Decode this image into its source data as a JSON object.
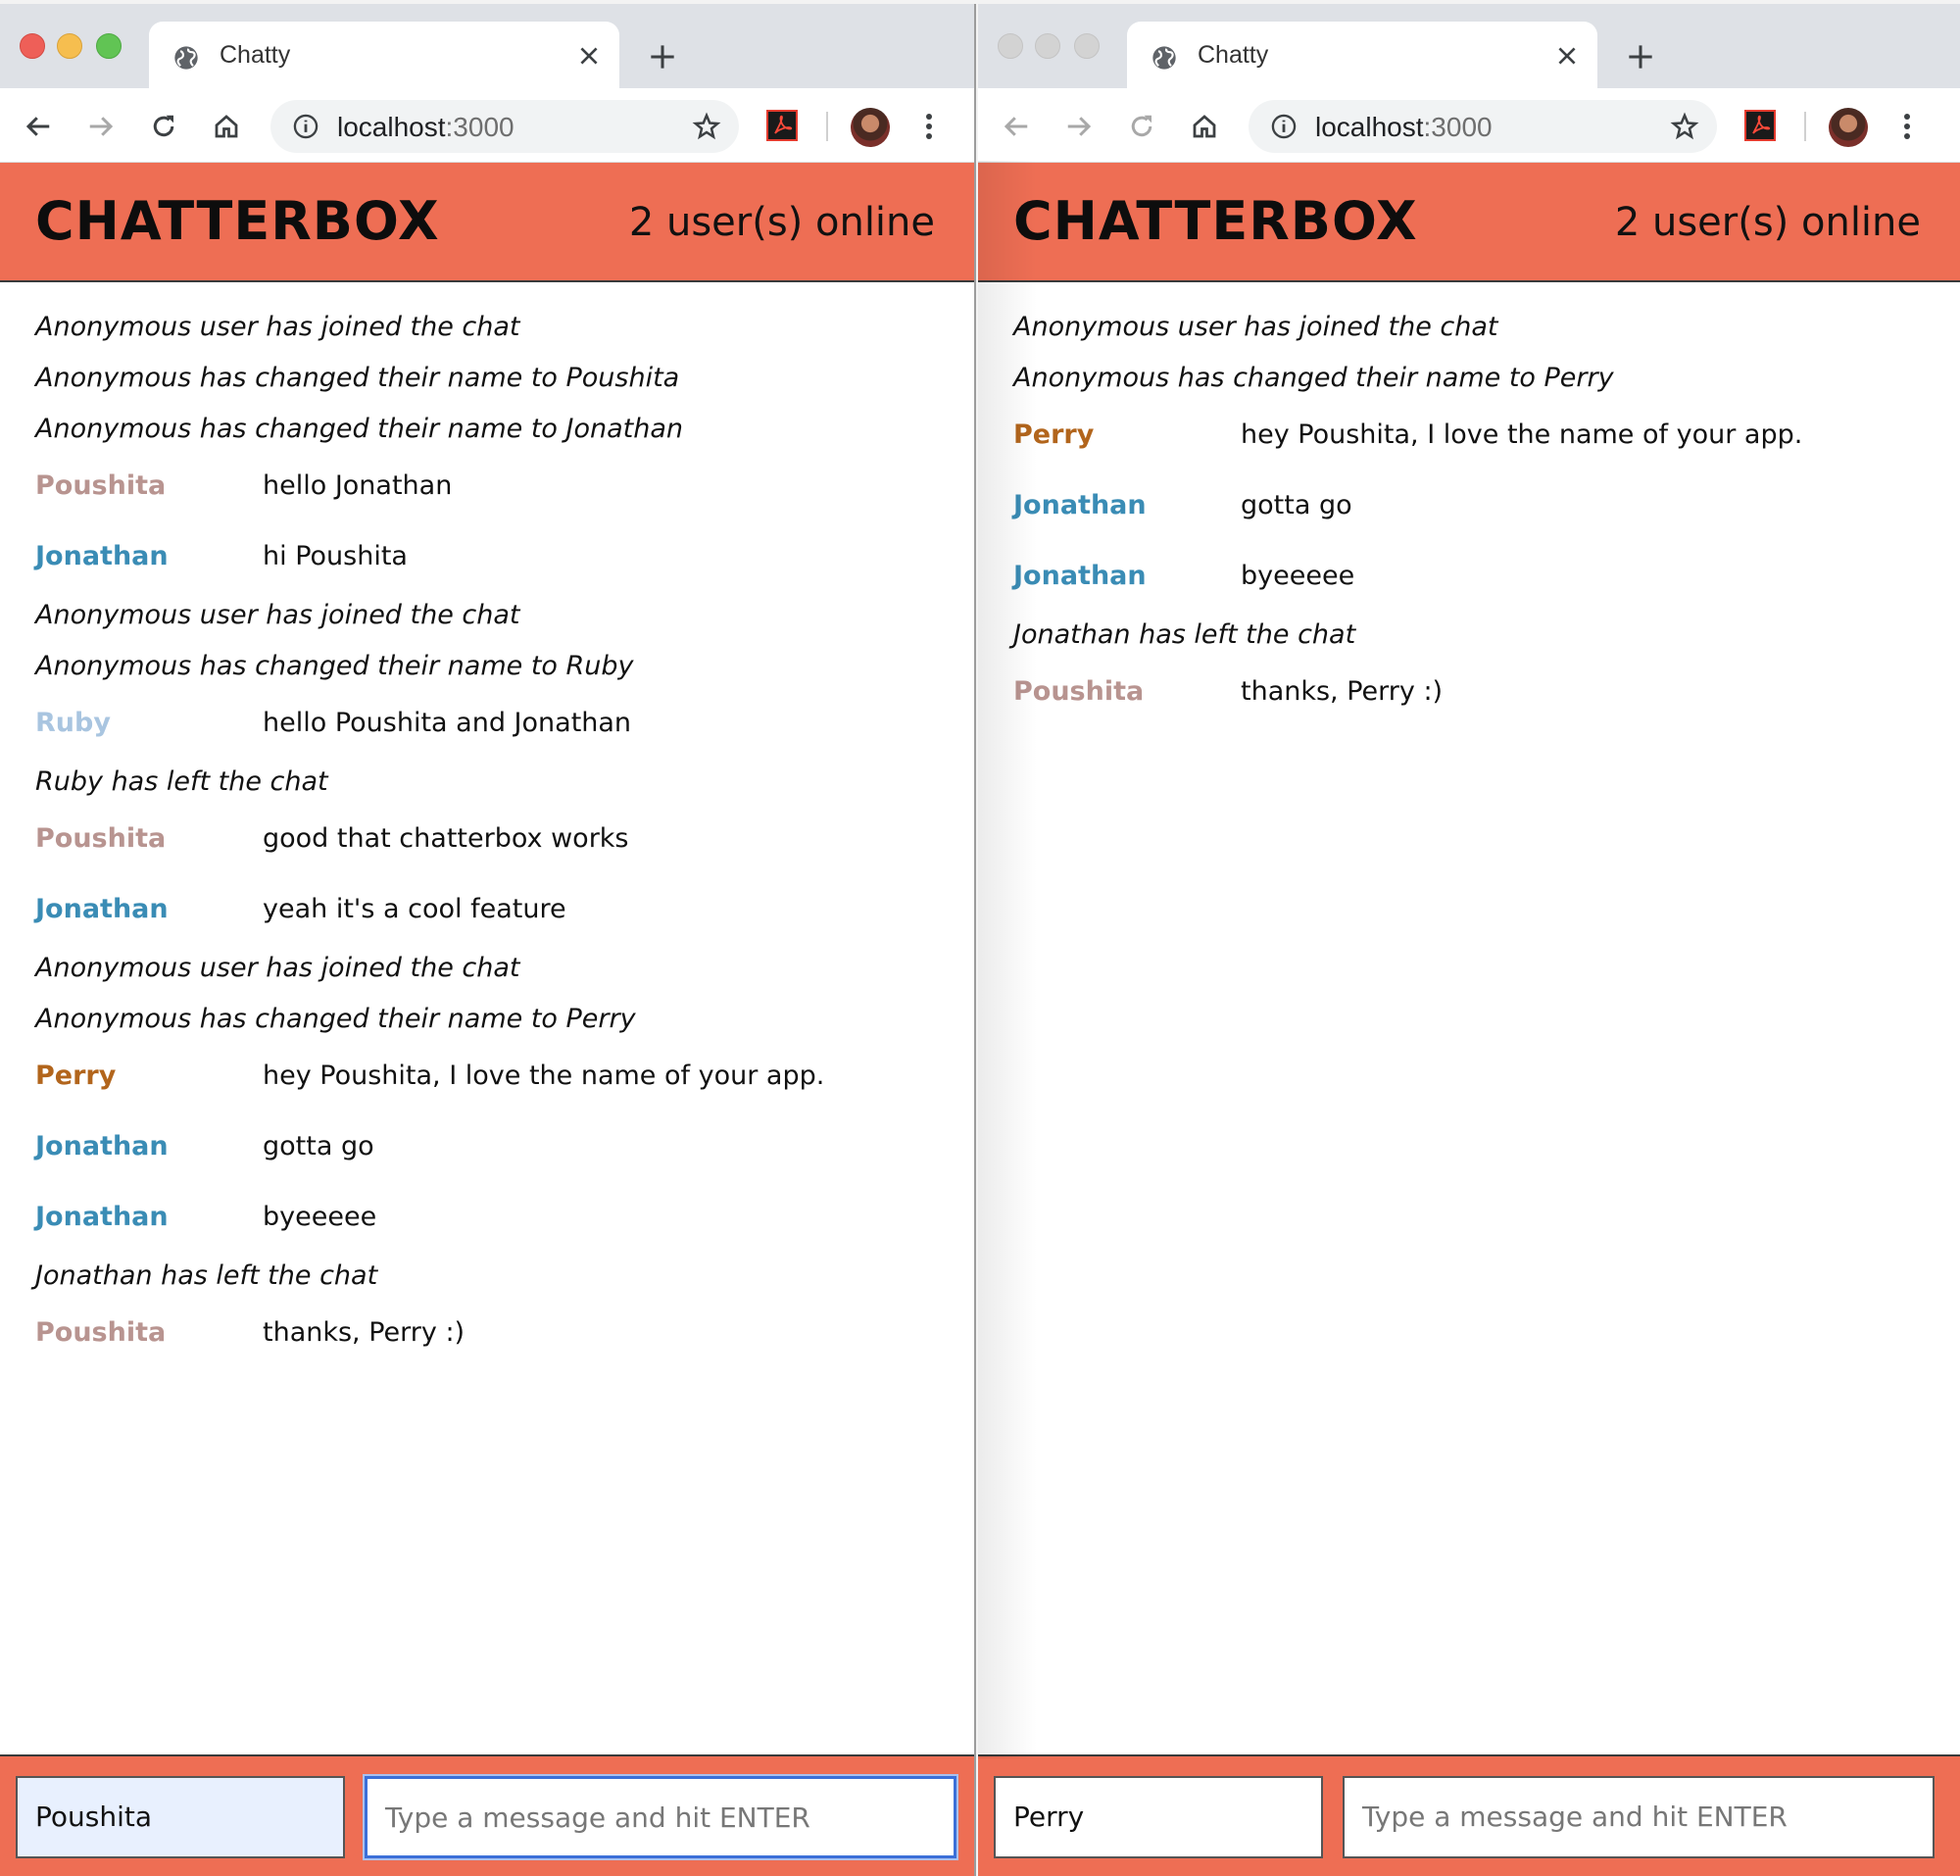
{
  "colors": {
    "header_bg": "#ee6e54",
    "poushita": "#b89490",
    "jonathan": "#3a8cb5",
    "ruby": "#a9c5e0",
    "perry": "#b2651c"
  },
  "windows": [
    {
      "browser": {
        "tab_title": "Chatty",
        "url_host": "localhost",
        "url_port": ":3000"
      },
      "app": {
        "brand": "CHATTERBOX",
        "online": "2 user(s) online",
        "messages": [
          {
            "type": "system",
            "text": "Anonymous user has joined the chat"
          },
          {
            "type": "system",
            "text": "Anonymous has changed their name to Poushita"
          },
          {
            "type": "system",
            "text": "Anonymous has changed their name to Jonathan"
          },
          {
            "type": "chat",
            "user": "Poushita",
            "text": "hello Jonathan",
            "color": "#b89490"
          },
          {
            "type": "chat",
            "user": "Jonathan",
            "text": "hi Poushita",
            "color": "#3a8cb5"
          },
          {
            "type": "system",
            "text": "Anonymous user has joined the chat"
          },
          {
            "type": "system",
            "text": "Anonymous has changed their name to Ruby"
          },
          {
            "type": "chat",
            "user": "Ruby",
            "text": "hello Poushita and Jonathan",
            "color": "#a9c5e0"
          },
          {
            "type": "system",
            "text": "Ruby has left the chat"
          },
          {
            "type": "chat",
            "user": "Poushita",
            "text": "good that chatterbox works",
            "color": "#b89490"
          },
          {
            "type": "chat",
            "user": "Jonathan",
            "text": "yeah it's a cool feature",
            "color": "#3a8cb5"
          },
          {
            "type": "system",
            "text": "Anonymous user has joined the chat"
          },
          {
            "type": "system",
            "text": "Anonymous has changed their name to Perry"
          },
          {
            "type": "chat",
            "user": "Perry",
            "text": "hey Poushita, I love the name of your app.",
            "color": "#b2651c"
          },
          {
            "type": "chat",
            "user": "Jonathan",
            "text": "gotta go",
            "color": "#3a8cb5"
          },
          {
            "type": "chat",
            "user": "Jonathan",
            "text": "byeeeee",
            "color": "#3a8cb5"
          },
          {
            "type": "system",
            "text": "Jonathan has left the chat"
          },
          {
            "type": "chat",
            "user": "Poushita",
            "text": "thanks, Perry :)",
            "color": "#b89490"
          }
        ],
        "username_value": "Poushita",
        "message_placeholder": "Type a message and hit ENTER"
      }
    },
    {
      "browser": {
        "tab_title": "Chatty",
        "url_host": "localhost",
        "url_port": ":3000"
      },
      "app": {
        "brand": "CHATTERBOX",
        "online": "2 user(s) online",
        "messages": [
          {
            "type": "system",
            "text": "Anonymous user has joined the chat"
          },
          {
            "type": "system",
            "text": "Anonymous has changed their name to Perry"
          },
          {
            "type": "chat",
            "user": "Perry",
            "text": "hey Poushita, I love the name of your app.",
            "color": "#b2651c"
          },
          {
            "type": "chat",
            "user": "Jonathan",
            "text": "gotta go",
            "color": "#3a8cb5"
          },
          {
            "type": "chat",
            "user": "Jonathan",
            "text": "byeeeee",
            "color": "#3a8cb5"
          },
          {
            "type": "system",
            "text": "Jonathan has left the chat"
          },
          {
            "type": "chat",
            "user": "Poushita",
            "text": "thanks, Perry :)",
            "color": "#b89490"
          }
        ],
        "username_value": "Perry",
        "message_placeholder": "Type a message and hit ENTER"
      }
    }
  ]
}
